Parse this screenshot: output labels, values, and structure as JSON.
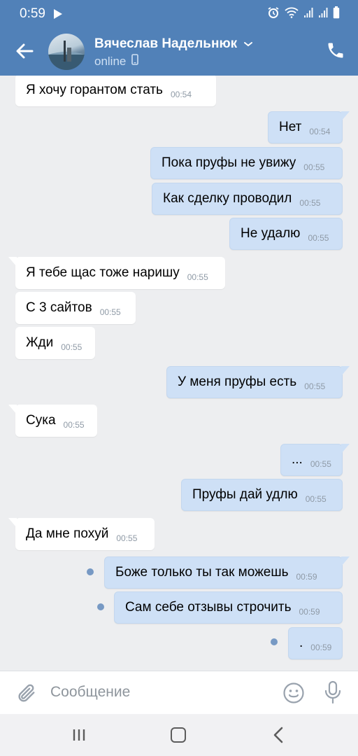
{
  "status_bar": {
    "time": "0:59",
    "icons": [
      "play-icon",
      "alarm-icon",
      "wifi-icon",
      "signal-icon",
      "signal-icon",
      "battery-icon"
    ]
  },
  "header": {
    "name": "Вячеслав Надельнюк",
    "status": "online",
    "icons": [
      "back-arrow-icon",
      "chevron-down-icon",
      "phone-icon",
      "mobile-device-icon"
    ]
  },
  "messages": [
    {
      "dir": "in",
      "text": "Я хочу горантом стать",
      "time": "00:54"
    },
    {
      "dir": "out",
      "text": "Нет",
      "time": "00:54"
    },
    {
      "dir": "out",
      "text": "Пока пруфы не увижу",
      "time": "00:55"
    },
    {
      "dir": "out",
      "text": "Как сделку проводил",
      "time": "00:55"
    },
    {
      "dir": "out",
      "text": "Не удалю",
      "time": "00:55"
    },
    {
      "dir": "in",
      "text": "Я тебе щас тоже наришу",
      "time": "00:55"
    },
    {
      "dir": "in",
      "text": "С 3 сайтов",
      "time": "00:55"
    },
    {
      "dir": "in",
      "text": "Жди",
      "time": "00:55"
    },
    {
      "dir": "out",
      "text": "У меня пруфы есть",
      "time": "00:55"
    },
    {
      "dir": "in",
      "text": "Сука",
      "time": "00:55"
    },
    {
      "dir": "out",
      "text": "...",
      "time": "00:55"
    },
    {
      "dir": "out",
      "text": "Пруфы дай удлю",
      "time": "00:55"
    },
    {
      "dir": "in",
      "text": "Да мне похуй",
      "time": "00:55"
    },
    {
      "dir": "out",
      "text": "Боже только ты так можешь",
      "time": "00:59",
      "unread": true
    },
    {
      "dir": "out",
      "text": "Сам себе отзывы строчить",
      "time": "00:59",
      "unread": true
    },
    {
      "dir": "out",
      "text": ".",
      "time": "00:59",
      "unread": true
    }
  ],
  "composer": {
    "placeholder": "Сообщение",
    "icons": [
      "attach-icon",
      "emoji-icon",
      "microphone-icon"
    ]
  },
  "navbar": {
    "icons": [
      "recent-apps-icon",
      "home-icon",
      "back-icon"
    ]
  },
  "colors": {
    "header": "#5181b8",
    "background": "#edeef0",
    "outgoing_bubble": "#cee0f6",
    "incoming_bubble": "#ffffff",
    "unread_dot": "#7799c4"
  }
}
